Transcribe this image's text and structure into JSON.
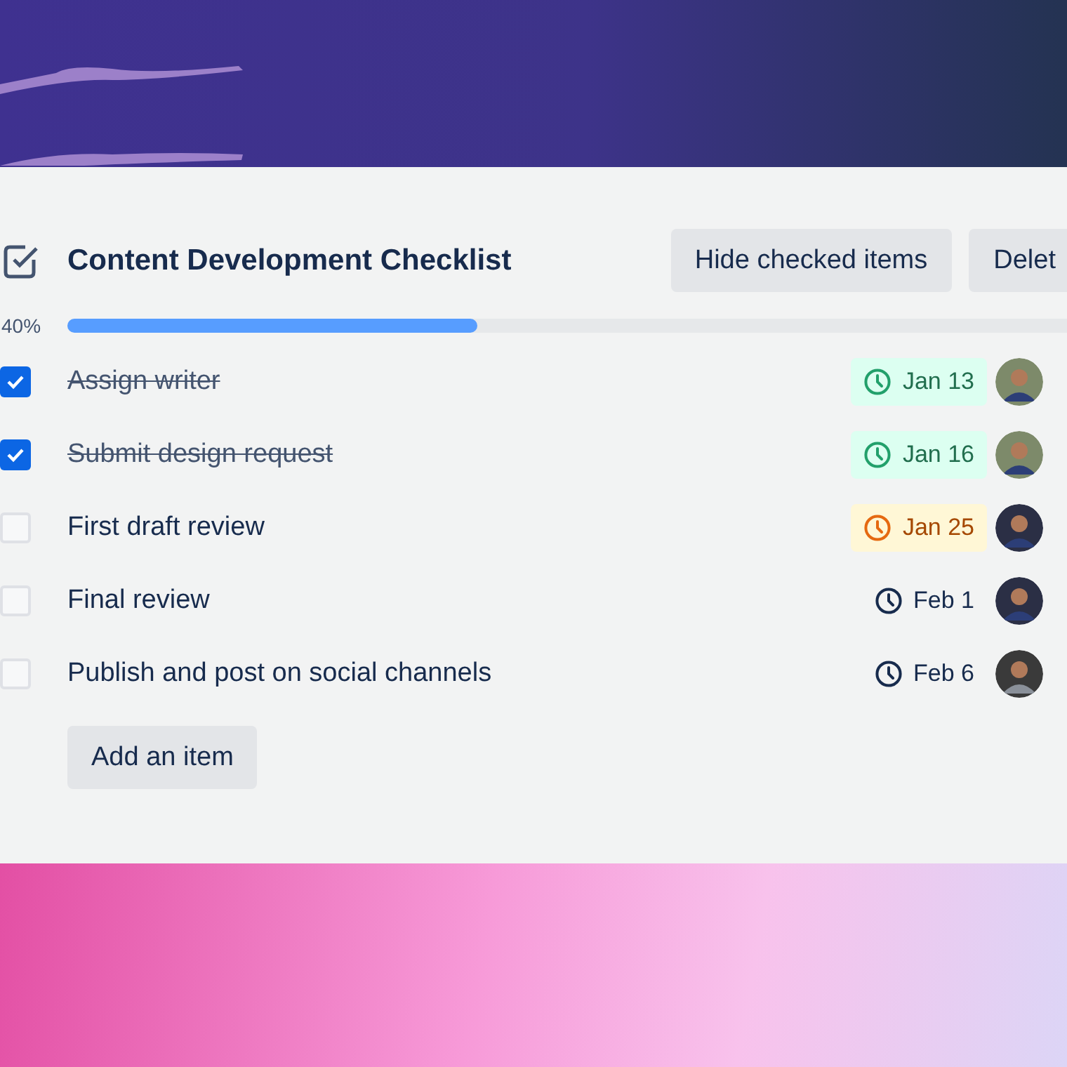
{
  "checklist": {
    "title": "Content Development Checklist",
    "buttons": [
      "Hide checked items",
      "Delet"
    ],
    "progress": {
      "label": "40%",
      "level": 0.41
    },
    "items": [
      {
        "text": "Assign writer",
        "checked": true,
        "due": "Jan 13",
        "kind": "done"
      },
      {
        "text": "Submit design request",
        "checked": true,
        "due": "Jan 16",
        "kind": "done"
      },
      {
        "text": "First draft review",
        "checked": false,
        "due": "Jan 25",
        "kind": "soon"
      },
      {
        "text": "Final review",
        "checked": false,
        "due": "Feb 1",
        "kind": "plain"
      },
      {
        "text": "Publish and post on social channels",
        "checked": false,
        "due": "Feb 6",
        "kind": "plain"
      }
    ],
    "add_button": "Add an item"
  }
}
